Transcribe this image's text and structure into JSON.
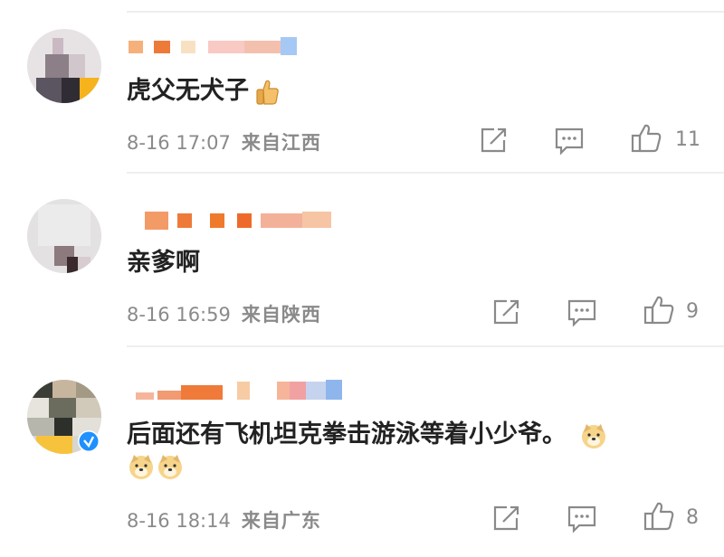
{
  "comments": [
    {
      "text": "虎父无犬子",
      "time": "8-16 17:07",
      "location": "来自江西",
      "likes": "11",
      "emoji": "thumbs-up"
    },
    {
      "text": "亲爹啊",
      "time": "8-16 16:59",
      "location": "来自陕西",
      "likes": "9"
    },
    {
      "text": "后面还有飞机坦克拳击游泳等着小少爷。",
      "time": "8-16 18:14",
      "location": "来自广东",
      "likes": "8",
      "emoji": "doge",
      "verified": true
    }
  ],
  "icons": {
    "share": "share-icon",
    "comment": "comment-icon",
    "like": "like-icon",
    "verified": "verified-icon"
  },
  "colors": {
    "text": "#222222",
    "meta": "#8a8a8a",
    "verified": "#1e90ff",
    "divider": "#efefef"
  }
}
